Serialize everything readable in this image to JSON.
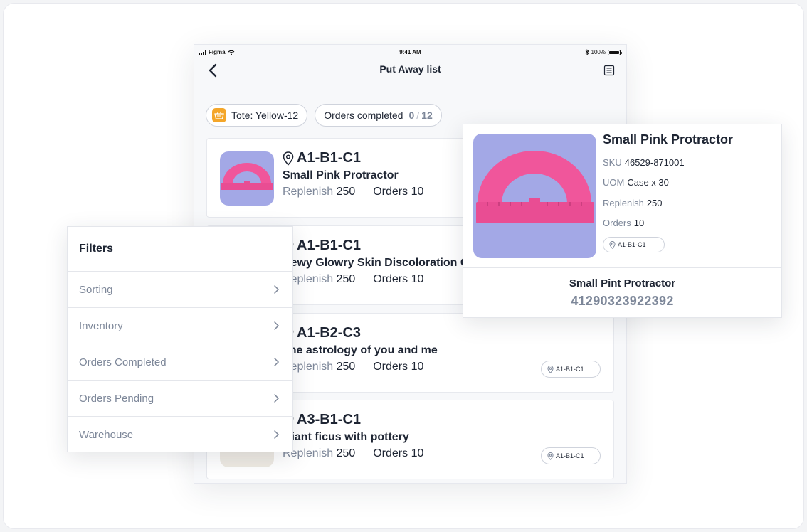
{
  "status_bar": {
    "carrier": "Figma",
    "time": "9:41 AM",
    "battery": "100%"
  },
  "nav": {
    "title": "Put Away list"
  },
  "chips": {
    "tote_label": "Tote: Yellow-12",
    "orders_label": "Orders completed",
    "orders_done": "0",
    "orders_separator": "/",
    "orders_total": "12"
  },
  "labels": {
    "replenish": "Replenish",
    "orders": "Orders"
  },
  "items": [
    {
      "location": "A1-B1-C1",
      "name": "Small Pink Protractor",
      "replenish": "250",
      "orders": "10"
    },
    {
      "location": "A1-B1-C1",
      "name": "Dewy Glowry Skin Discoloration Oil for",
      "replenish": "250",
      "orders": "10"
    },
    {
      "location": "A1-B2-C3",
      "name": "The astrology of you and me",
      "replenish": "250",
      "orders": "10",
      "loc_chip": "A1-B1-C1"
    },
    {
      "location": "A3-B1-C1",
      "name": "Giant ficus with pottery",
      "replenish": "250",
      "orders": "10",
      "loc_chip": "A1-B1-C1"
    }
  ],
  "filters": {
    "title": "Filters",
    "rows": [
      "Sorting",
      "Inventory",
      "Orders Completed",
      "Orders Pending",
      "Warehouse"
    ]
  },
  "detail": {
    "name": "Small Pink Protractor",
    "sku_label": "SKU",
    "sku": "46529-871001",
    "uom_label": "UOM",
    "uom": "Case x 30",
    "replenish_label": "Replenish",
    "replenish": "250",
    "orders_label": "Orders",
    "orders": "10",
    "location": "A1-B1-C1",
    "barcode_name": "Small Pint Protractor",
    "barcode": "41290323922392"
  },
  "colors": {
    "accent_tote": "#f4a629",
    "thumb_bg": "#a3a8e6",
    "protractor": "#f0569b",
    "muted_text": "#7d8799"
  }
}
